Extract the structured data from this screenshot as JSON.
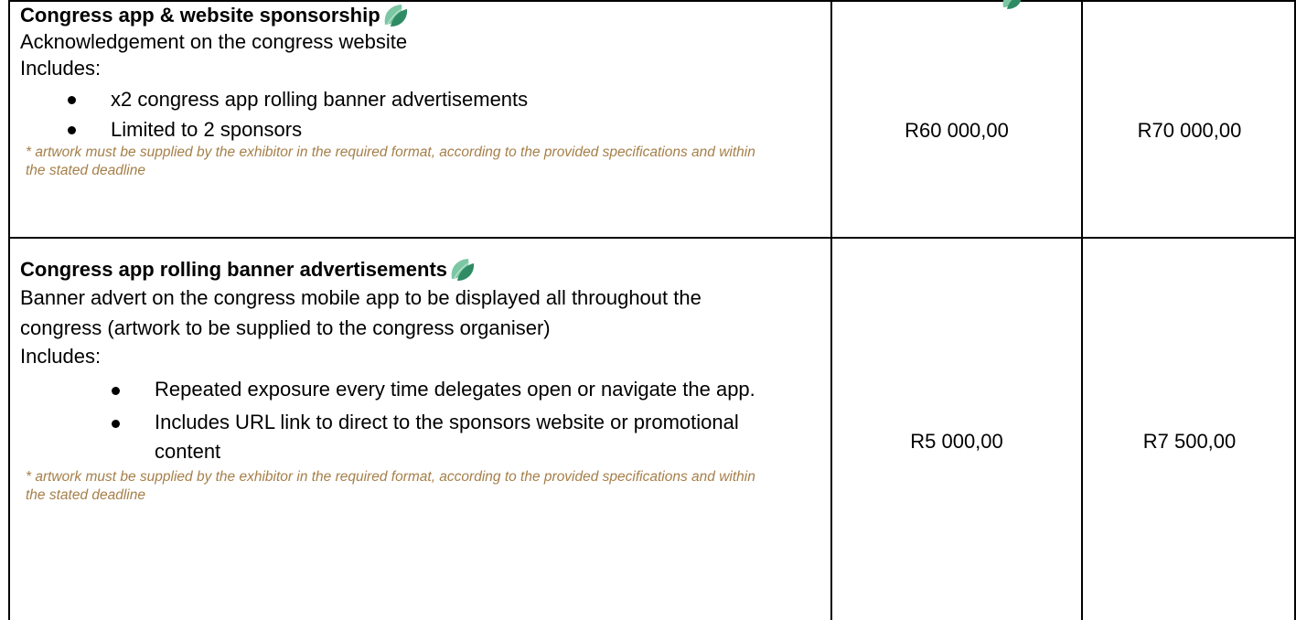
{
  "rows": [
    {
      "title": "Congress app & website sponsorship",
      "lines": [
        "Acknowledgement on the congress website",
        "Includes:"
      ],
      "bullets": [
        "x2 congress app rolling banner advertisements",
        "Limited to 2 sponsors"
      ],
      "note": "* artwork must be supplied by the exhibitor in the required format, according to the provided specifications and within the stated deadline",
      "price_1": "R60 000,00",
      "price_2": "R70 000,00"
    },
    {
      "title": "Congress app rolling banner advertisements",
      "description": "Banner advert on the congress mobile app to be displayed all throughout the congress (artwork to be supplied to the congress organiser)",
      "includes_label": "Includes:",
      "bullets": [
        "Repeated exposure every time delegates open or navigate the app.",
        "Includes URL link to direct to the sponsors website or promotional content"
      ],
      "note": "* artwork must be supplied by the exhibitor in the required format, according to the provided specifications and within the stated deadline",
      "price_1": "R5 000,00",
      "price_2": "R7 500,00"
    }
  ],
  "icons": {
    "leaf": "eco-leaf-icon",
    "leaf_colors": [
      "#7cc7a3",
      "#2e8b63"
    ]
  }
}
